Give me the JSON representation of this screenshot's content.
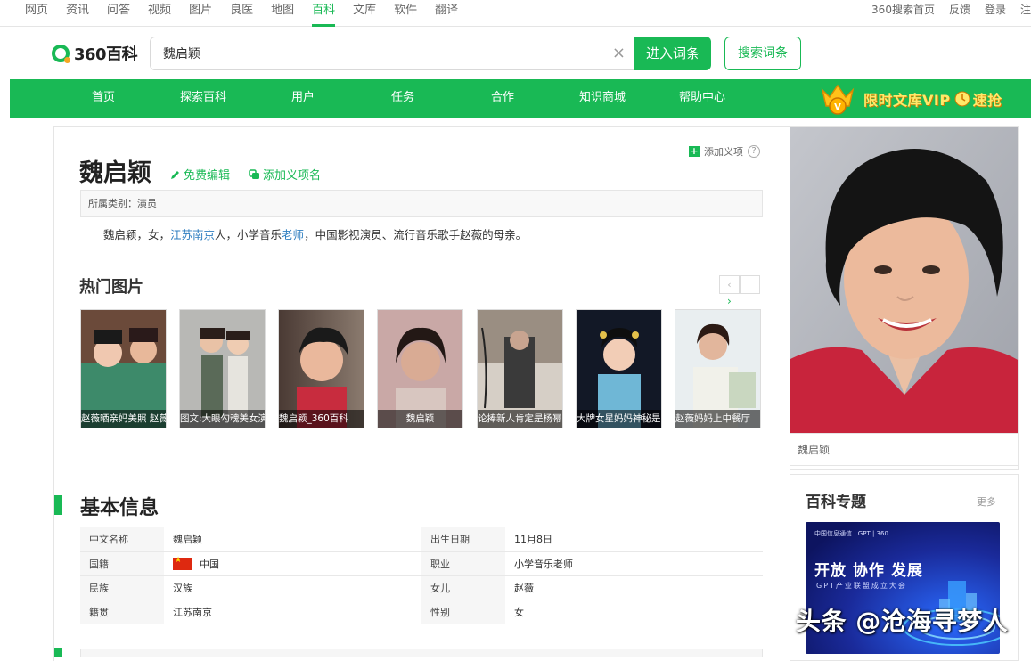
{
  "topnav": {
    "left": [
      "网页",
      "资讯",
      "问答",
      "视频",
      "图片",
      "良医",
      "地图",
      "百科",
      "文库",
      "软件",
      "翻译"
    ],
    "active": "百科",
    "right": [
      "360搜索首页",
      "反馈",
      "登录",
      "注"
    ]
  },
  "header": {
    "logo_text": "360百科",
    "search_value": "魏启颖",
    "clear_icon": "×",
    "enter_button": "进入词条",
    "search_button": "搜索词条"
  },
  "greenbar": {
    "items": [
      "首页",
      "探索百科",
      "用户",
      "任务",
      "合作",
      "知识商城",
      "帮助中心"
    ],
    "vip_text": "限时文库VIP",
    "vip_suffix": "速抢"
  },
  "entry": {
    "add_meaning": "添加义项",
    "title": "魏启颖",
    "edit_label": "免费编辑",
    "add_name_label": "添加义项名",
    "category": "所属类别：演员",
    "summary_parts": [
      "魏启颖，女，",
      "江苏南京",
      "人，小学音乐",
      "老师",
      "，中国影视演员、流行音乐歌手赵薇的母亲。"
    ]
  },
  "hot_images": {
    "title": "热门图片",
    "prev_glyph": "‹",
    "next_glyph": "›",
    "items": [
      {
        "caption": "赵薇晒亲妈美照 赵薇"
      },
      {
        "caption": "图文:大眼勾魂美女演"
      },
      {
        "caption": "魏启颖_360百科"
      },
      {
        "caption": "魏启颖"
      },
      {
        "caption": "论捧新人肯定是杨幂"
      },
      {
        "caption": "大牌女星妈妈神秘是"
      },
      {
        "caption": "赵薇妈妈上中餐厅"
      }
    ]
  },
  "basic_info": {
    "title": "基本信息",
    "rows": [
      {
        "k1": "中文名称",
        "v1": "魏启颖",
        "k2": "出生日期",
        "v2": "11月8日"
      },
      {
        "k1": "国籍",
        "v1": "中国",
        "k2": "职业",
        "v2": "小学音乐老师"
      },
      {
        "k1": "民族",
        "v1": "汉族",
        "k2": "女儿",
        "v2": "赵薇"
      },
      {
        "k1": "籍贯",
        "v1": "江苏南京",
        "k2": "性别",
        "v2": "女"
      }
    ]
  },
  "sidebar": {
    "portrait_caption": "魏启颖",
    "topics_title": "百科专题",
    "topics_more": "更多",
    "banner_top": "中国信息通信 | GPT | 360",
    "banner_title": "开放 协作 发展",
    "banner_subtitle": "GPT产业联盟成立大会"
  },
  "watermark": "头条 @沧海寻梦人",
  "colors": {
    "brand": "#19b955",
    "link": "#2e7ec0"
  }
}
